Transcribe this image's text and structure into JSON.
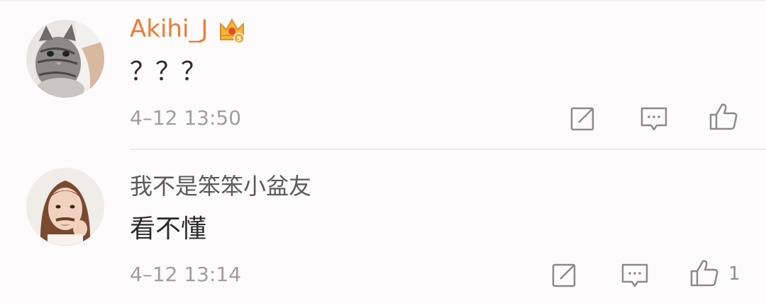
{
  "comments": [
    {
      "username": "Akihi_J",
      "username_color": "#ee7a33",
      "badge_icon": "crown-vip-badge-icon",
      "text": "？？？",
      "timestamp": "4–12 13:50",
      "avatar_icon": "cat-avatar",
      "actions": [
        "repost-icon",
        "comment-icon",
        "thumbs-up-icon"
      ],
      "like_count": ""
    },
    {
      "username": "我不是笨笨小盆友",
      "username_color": "#5a5a5a",
      "text": "看不懂",
      "timestamp": "4–12 13:14",
      "avatar_icon": "woman-avatar",
      "actions": [
        "repost-icon",
        "comment-icon",
        "thumbs-up-icon"
      ],
      "like_count": "1"
    }
  ],
  "colors": {
    "background": "#fdfbfb",
    "vip_name": "#ee7a33",
    "icon_gray": "#8a8a8a",
    "timestamp": "#9e9e9e"
  }
}
